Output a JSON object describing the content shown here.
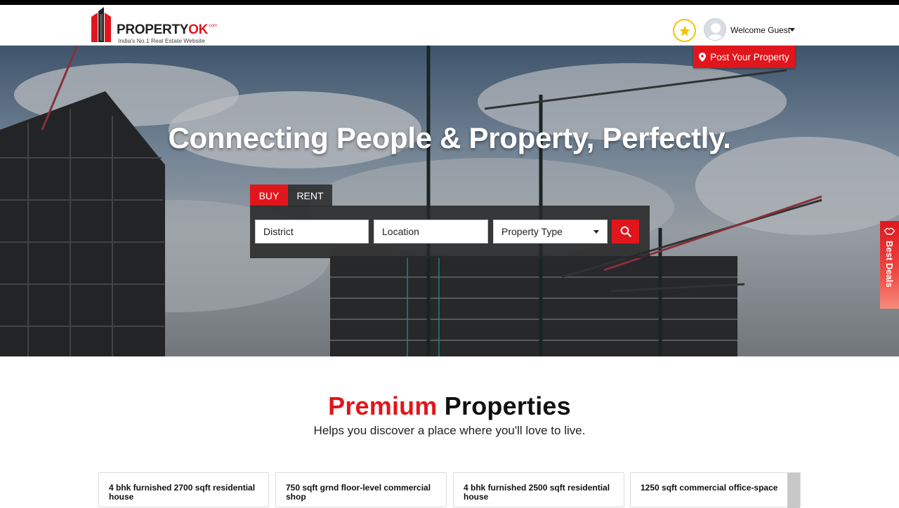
{
  "header": {
    "logo_brand": "PROPERTY",
    "logo_brand_accent": "OK",
    "logo_domain": ".com",
    "logo_tagline": "India's No.1 Real Estate Website",
    "welcome_text": "Welcome Guest"
  },
  "hero": {
    "post_button_label": "Post Your Property",
    "title": "Connecting People & Property, Perfectly.",
    "tabs": [
      {
        "label": "BUY",
        "active": true
      },
      {
        "label": "RENT",
        "active": false
      }
    ],
    "search": {
      "district_placeholder": "District",
      "location_placeholder": "Location",
      "property_type_value": "Property Type"
    },
    "best_deals_label": "Best Deals"
  },
  "premium": {
    "title_accent": "Premium",
    "title_rest": "Properties",
    "subtitle": "Helps you discover a place where you'll love to live."
  },
  "cards": [
    {
      "title": "4 bhk furnished 2700 sqft residential house"
    },
    {
      "title": "750 sqft grnd floor-level commercial shop"
    },
    {
      "title": "4 bhk furnished 2500 sqft residential house"
    },
    {
      "title": "1250 sqft commercial office-space"
    }
  ],
  "colors": {
    "brand_red": "#e1161d",
    "star_yellow": "#f2c200"
  },
  "icons": {
    "favorites": "star-icon",
    "user": "avatar",
    "post": "map-pin-icon",
    "search": "search-icon",
    "deals": "handshake-icon"
  }
}
